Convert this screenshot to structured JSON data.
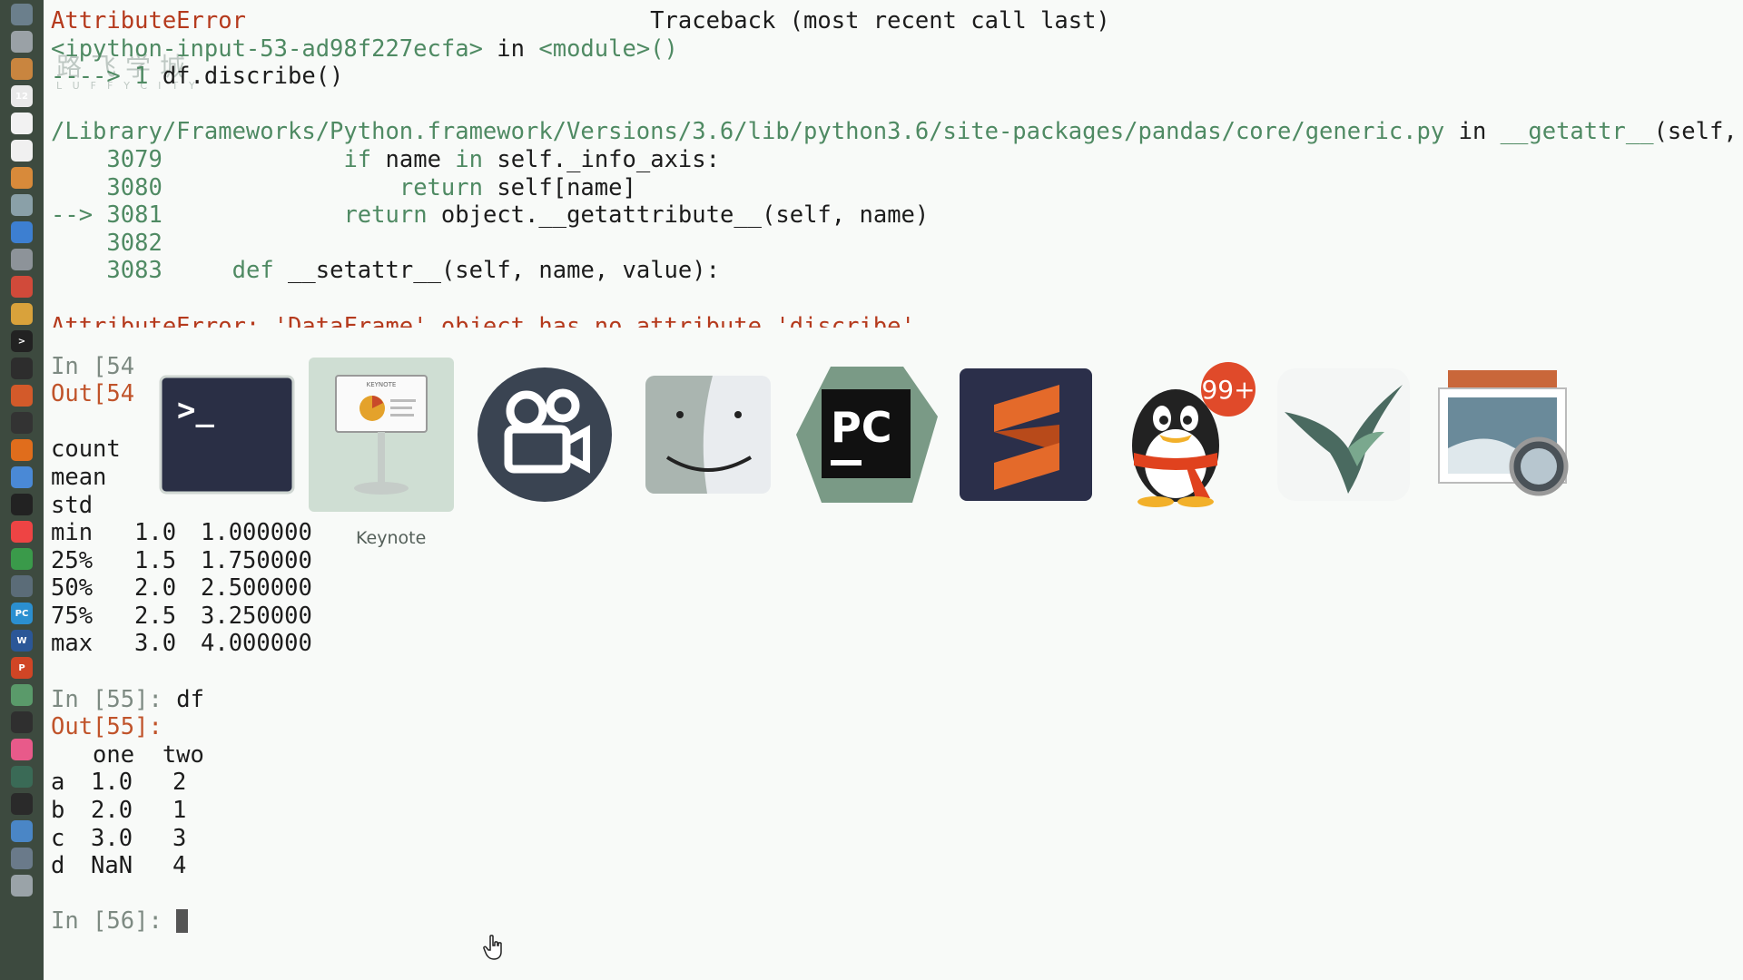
{
  "traceback": {
    "error_name": "AttributeError",
    "header": "Traceback (most recent call last)",
    "input_ref": "<ipython-input-53-ad98f227ecfa>",
    "in_word": "in",
    "module_ref": "<module>()",
    "arrow_line_prefix": "----> 1",
    "arrow_line_code": "df.discribe()",
    "file_path": "/Library/Frameworks/Python.framework/Versions/3.6/lib/python3.6/site-packages/pandas/core/generic.py",
    "func_name": "__getattr__",
    "func_args": "(self, name)",
    "code_lines": [
      {
        "marker": "   ",
        "num": "3079",
        "indent": "            ",
        "kw": "if",
        "rest_pre": " name ",
        "kw2": "in",
        "rest": " self._info_axis:"
      },
      {
        "marker": "   ",
        "num": "3080",
        "indent": "                ",
        "kw": "return",
        "rest_pre": " self[name]",
        "kw2": "",
        "rest": ""
      },
      {
        "marker": "-->",
        "num": "3081",
        "indent": "            ",
        "kw": "return",
        "rest_pre": " object.__getattribute__(self, name)",
        "kw2": "",
        "rest": ""
      },
      {
        "marker": "   ",
        "num": "3082",
        "indent": "",
        "kw": "",
        "rest_pre": "",
        "kw2": "",
        "rest": ""
      },
      {
        "marker": "   ",
        "num": "3083",
        "indent": "    ",
        "kw": "def",
        "rest_pre": " __setattr__(self, name, value):",
        "kw2": "",
        "rest": ""
      }
    ],
    "final_error": "AttributeError: 'DataFrame' object has no attribute 'discribe'"
  },
  "cell54": {
    "in_prompt": "In [54",
    "out_prompt": "Out[54",
    "stats": [
      {
        "label": "count",
        "one": "",
        "two": ""
      },
      {
        "label": "mean",
        "one": "",
        "two": ""
      },
      {
        "label": "std",
        "one": "",
        "two": ""
      },
      {
        "label": "min",
        "one": "1.0",
        "two": "1.000000"
      },
      {
        "label": "25%",
        "one": "1.5",
        "two": "1.750000"
      },
      {
        "label": "50%",
        "one": "2.0",
        "two": "2.500000"
      },
      {
        "label": "75%",
        "one": "2.5",
        "two": "3.250000"
      },
      {
        "label": "max",
        "one": "3.0",
        "two": "4.000000"
      }
    ]
  },
  "cell55": {
    "in_prefix": "In [",
    "in_num": "55",
    "in_suffix": "]:",
    "in_code": "df",
    "out_prefix": "Out[",
    "out_num": "55",
    "out_suffix": "]:",
    "header": "   one  two",
    "rows": [
      {
        "idx": "a",
        "one": "1.0",
        "two": "2"
      },
      {
        "idx": "b",
        "one": "2.0",
        "two": "1"
      },
      {
        "idx": "c",
        "one": "3.0",
        "two": "3"
      },
      {
        "idx": "d",
        "one": "NaN",
        "two": "4"
      }
    ]
  },
  "cell56": {
    "in_prefix": "In [",
    "in_num": "56",
    "in_suffix": "]:"
  },
  "watermark": {
    "cn": "路飞学城",
    "en": "LUFFYCITY"
  },
  "app_switcher": {
    "selected_label": "Keynote",
    "apps": [
      {
        "name": "terminal-icon",
        "glyph": ">_"
      },
      {
        "name": "keynote-icon",
        "glyph": "KEYNOTE"
      },
      {
        "name": "screen-recorder-icon",
        "glyph": ""
      },
      {
        "name": "finder-icon",
        "glyph": ""
      },
      {
        "name": "pycharm-icon",
        "glyph": "PC"
      },
      {
        "name": "sublime-text-icon",
        "glyph": ""
      },
      {
        "name": "qq-icon",
        "glyph": "",
        "badge": "99+"
      },
      {
        "name": "bird-app-icon",
        "glyph": ""
      },
      {
        "name": "preview-icon",
        "glyph": ""
      }
    ]
  },
  "dock": {
    "items": [
      {
        "name": "compass-icon",
        "color": "#6b7f8c",
        "glyph": ""
      },
      {
        "name": "contacts-icon",
        "color": "#9aa1a6",
        "glyph": ""
      },
      {
        "name": "notes-icon",
        "color": "#c9853f",
        "glyph": ""
      },
      {
        "name": "calendar-icon",
        "color": "#e9e9e9",
        "glyph": "12"
      },
      {
        "name": "reminders-icon",
        "color": "#f2f2f2",
        "glyph": ""
      },
      {
        "name": "text-edit-icon",
        "color": "#f0f0f0",
        "glyph": ""
      },
      {
        "name": "pages-icon",
        "color": "#d88a3a",
        "glyph": ""
      },
      {
        "name": "preview-dock-icon",
        "color": "#8aa0a8",
        "glyph": ""
      },
      {
        "name": "app-store-icon",
        "color": "#3d7fd1",
        "glyph": ""
      },
      {
        "name": "settings-icon",
        "color": "#8d9399",
        "glyph": ""
      },
      {
        "name": "photos-icon",
        "color": "#d14a3a",
        "glyph": ""
      },
      {
        "name": "chrome-icon",
        "color": "#d9a23b",
        "glyph": ""
      },
      {
        "name": "terminal-dock-icon",
        "color": "#222",
        "glyph": ">"
      },
      {
        "name": "qq-dock-icon",
        "color": "#2d2d2d",
        "glyph": ""
      },
      {
        "name": "sublime-dock-icon",
        "color": "#d35a2a",
        "glyph": ""
      },
      {
        "name": "quicktime-icon",
        "color": "#333",
        "glyph": ""
      },
      {
        "name": "vlc-icon",
        "color": "#e06d1c",
        "glyph": ""
      },
      {
        "name": "keynote-dock-icon",
        "color": "#4a89d6",
        "glyph": ""
      },
      {
        "name": "penguin-dock-icon",
        "color": "#222",
        "glyph": ""
      },
      {
        "name": "airmail-icon",
        "color": "#e44",
        "glyph": ""
      },
      {
        "name": "numbers-icon",
        "color": "#3a9a4a",
        "glyph": ""
      },
      {
        "name": "screenshot-icon",
        "color": "#5b6c78",
        "glyph": ""
      },
      {
        "name": "pycharm-dock-icon",
        "color": "#2b8fd0",
        "glyph": "PC"
      },
      {
        "name": "word-icon",
        "color": "#2b5797",
        "glyph": "W"
      },
      {
        "name": "powerpoint-icon",
        "color": "#d04525",
        "glyph": "P"
      },
      {
        "name": "maps-icon",
        "color": "#5a9a6a",
        "glyph": ""
      },
      {
        "name": "location-icon",
        "color": "#2f2f2f",
        "glyph": ""
      },
      {
        "name": "itunes-icon",
        "color": "#e85a8a",
        "glyph": ""
      },
      {
        "name": "bird-dock-icon",
        "color": "#3a6a56",
        "glyph": ""
      },
      {
        "name": "camera-icon",
        "color": "#2a2a2a",
        "glyph": ""
      },
      {
        "name": "folder-icon",
        "color": "#4a86c6",
        "glyph": ""
      },
      {
        "name": "downloads-icon",
        "color": "#6a7a8a",
        "glyph": ""
      },
      {
        "name": "trash-icon",
        "color": "#9aa3a8",
        "glyph": ""
      }
    ]
  }
}
